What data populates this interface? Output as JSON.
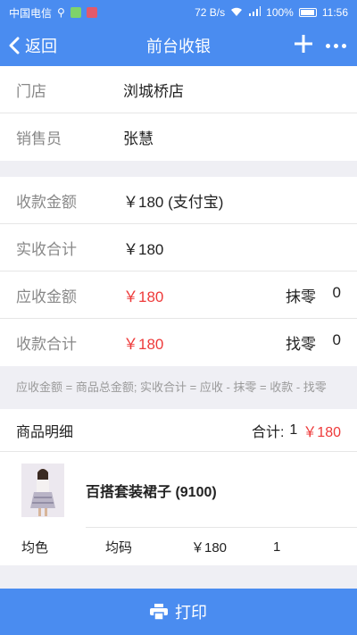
{
  "status_bar": {
    "carrier": "中国电信",
    "speed": "72 B/s",
    "battery": "100%",
    "time": "11:56"
  },
  "nav": {
    "back_label": "返回",
    "title": "前台收银"
  },
  "store": {
    "rows": [
      {
        "label": "门店",
        "value": "浏城桥店"
      },
      {
        "label": "销售员",
        "value": "张慧"
      }
    ]
  },
  "payment": {
    "collect_amount": {
      "label": "收款金额",
      "value": "￥180  (支付宝)"
    },
    "actual_total": {
      "label": "实收合计",
      "value": "￥180"
    },
    "due_amount": {
      "label": "应收金额",
      "value": "￥180",
      "right_label": "抹零",
      "right_value": "0"
    },
    "collect_total": {
      "label": "收款合计",
      "value": "￥180",
      "right_label": "找零",
      "right_value": "0"
    }
  },
  "note": "应收金额 = 商品总金额; 实收合计 = 应收 - 抹零 = 收款 - 找零",
  "goods": {
    "header": "商品明细",
    "total_label": "合计:",
    "total_count": "1",
    "total_price": "￥180",
    "items": [
      {
        "name": "百搭套装裙子 (9100)",
        "color": "均色",
        "size": "均码",
        "price": "￥180",
        "qty": "1"
      }
    ]
  },
  "print_label": "打印",
  "colors": {
    "primary": "#4a8cf0",
    "red": "#ee3a3a"
  },
  "icons": {
    "back": "chevron-left-icon",
    "add": "plus-icon",
    "more": "more-icon",
    "print": "printer-icon"
  }
}
